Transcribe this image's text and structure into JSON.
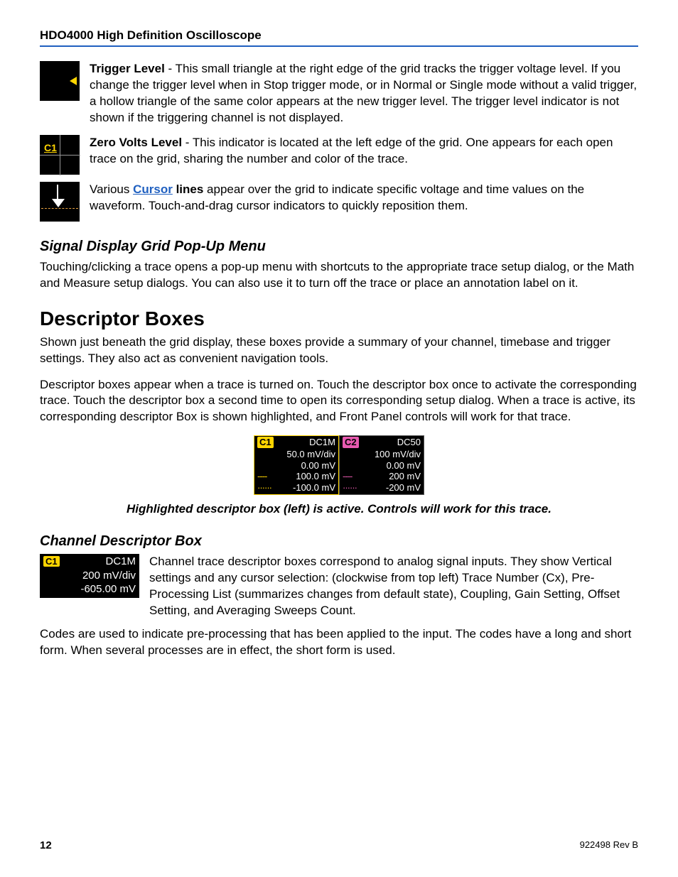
{
  "header": "HDO4000 High Definition Oscilloscope",
  "sections": {
    "trigger": {
      "label": "Trigger Level",
      "text_after": " - This small triangle at the right edge of the grid tracks the trigger voltage level. If you change the trigger level when in Stop trigger mode, or in Normal or Single mode without a valid trigger, a hollow triangle of the same color appears at the new trigger level. The trigger level indicator is not shown if the triggering channel is not displayed."
    },
    "zero": {
      "label": "Zero Volts Level",
      "text_after": " - This indicator is located at the left edge of the grid. One appears for each open trace on the grid, sharing the number and color of the trace.",
      "icon_label": "C1"
    },
    "cursor": {
      "pre": "Various ",
      "link": "Cursor",
      "post_bold": " lines",
      "post": " appear over the grid to indicate specific voltage and time values on the waveform. Touch-and-drag cursor indicators to quickly reposition them."
    },
    "popup": {
      "heading": "Signal Display Grid Pop-Up Menu",
      "text": "Touching/clicking a trace opens a pop-up menu with shortcuts to the appropriate trace setup dialog, or the Math and Measure setup dialogs. You can also use it to turn off the trace or place an annotation label on it."
    },
    "descriptor": {
      "heading": "Descriptor Boxes",
      "p1": "Shown just beneath the grid display, these boxes provide a summary of your channel, timebase and trigger settings. They also act as convenient navigation tools.",
      "p2": "Descriptor boxes appear when a trace is turned on. Touch the descriptor box once to activate the corresponding trace. Touch the descriptor box a second time to open its corresponding setup dialog. When a trace is active, its corresponding descriptor Box is shown highlighted, and Front Panel controls will work for that trace."
    },
    "boxes": [
      {
        "tag": "C1",
        "coupling": "DC1M",
        "gain": "50.0 mV/div",
        "offset": "0.00 mV",
        "hi": "100.0 mV",
        "lo": "-100.0 mV"
      },
      {
        "tag": "C2",
        "coupling": "DC50",
        "gain": "100 mV/div",
        "offset": "0.00 mV",
        "hi": "200 mV",
        "lo": "-200 mV"
      }
    ],
    "caption": "Highlighted descriptor box (left) is active. Controls will work for this trace.",
    "chan": {
      "heading": "Channel Descriptor Box",
      "box": {
        "tag": "C1",
        "coupling": "DC1M",
        "gain": "200 mV/div",
        "offset": "-605.00 mV"
      },
      "text": "Channel trace descriptor boxes correspond to analog signal inputs. They show Vertical settings and any cursor selection: (clockwise from top left) Trace Number (Cx), Pre-Processing List (summarizes changes from default state), Coupling, Gain Setting, Offset Setting, and Averaging Sweeps Count."
    },
    "codes": "Codes are used to indicate pre-processing that has been applied to the input. The codes have a long and short form. When several processes are in effect, the short form is used."
  },
  "footer": {
    "page": "12",
    "rev": "922498 Rev B"
  }
}
